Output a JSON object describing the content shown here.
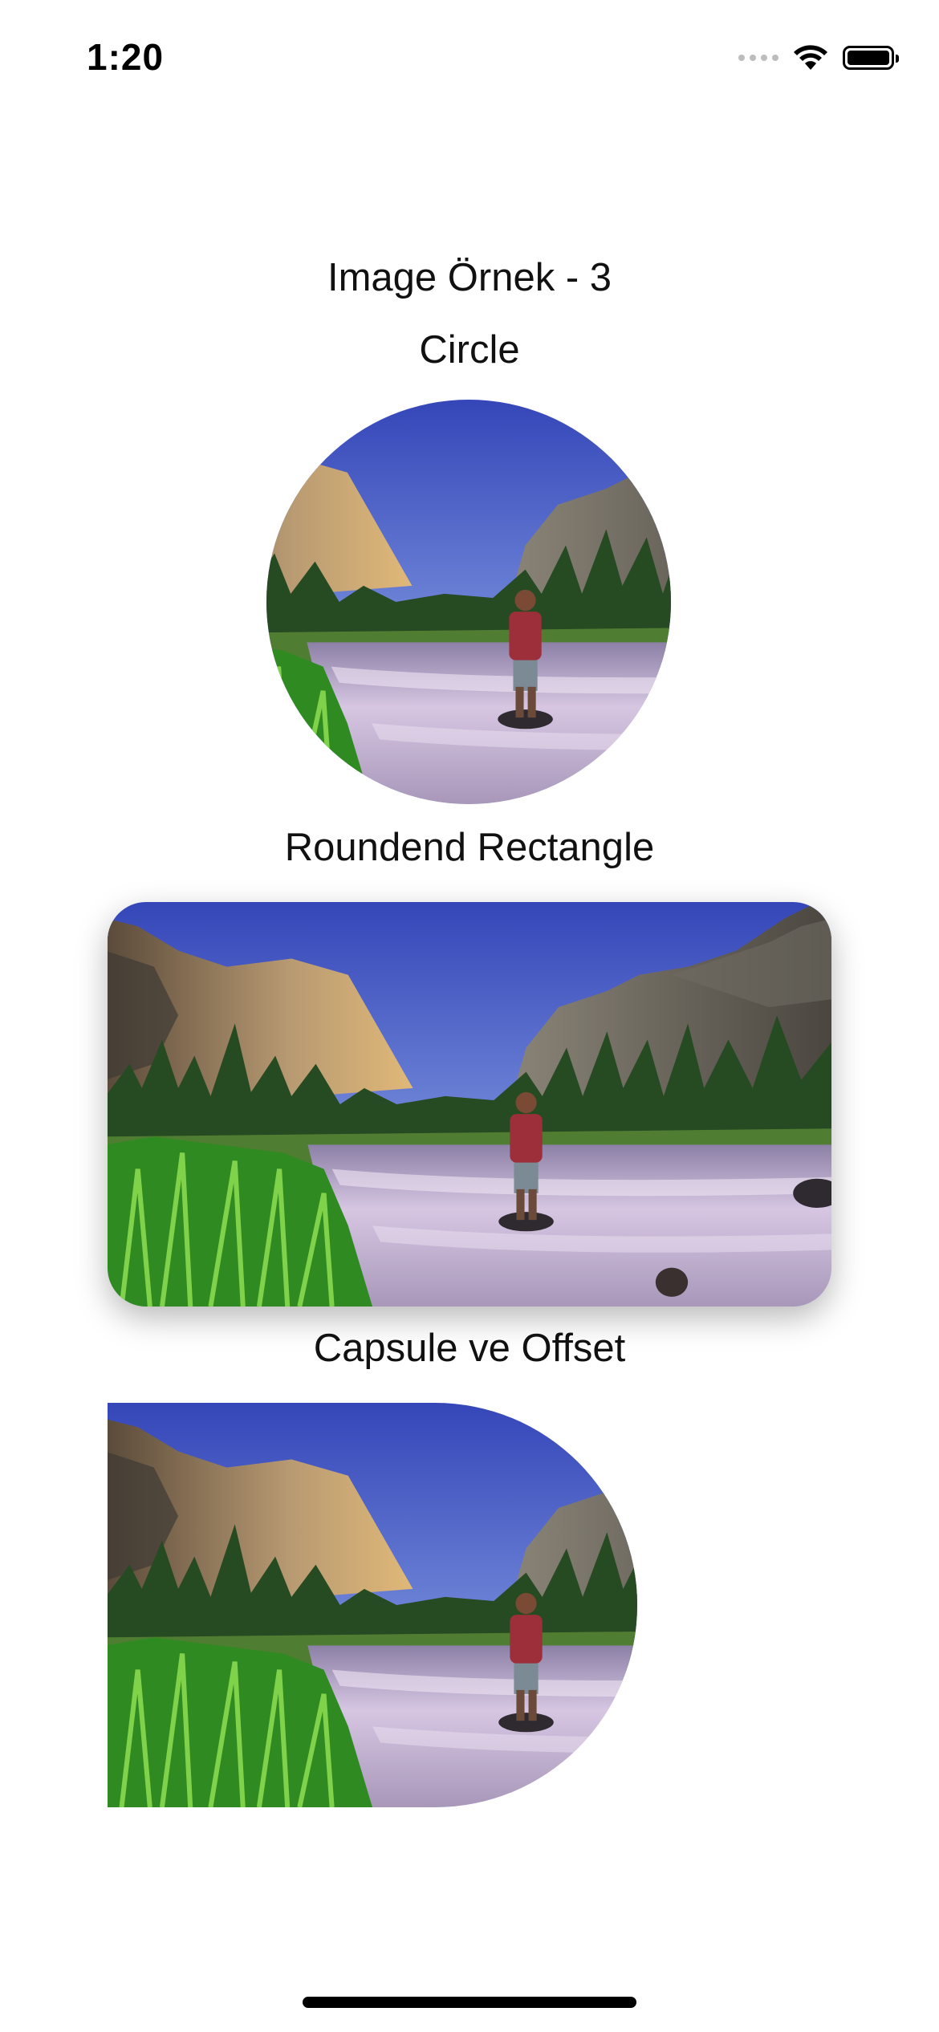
{
  "status_bar": {
    "time": "1:20",
    "icons": [
      "signal-icon",
      "wifi-icon",
      "battery-icon"
    ]
  },
  "content": {
    "title": "Image Örnek - 3",
    "sections": [
      {
        "label": "Circle",
        "shape": "circle"
      },
      {
        "label": "Roundend Rectangle",
        "shape": "rounded-rectangle"
      },
      {
        "label": "Capsule ve Offset",
        "shape": "capsule"
      }
    ]
  },
  "image": {
    "description_icon": "landscape-photo"
  },
  "colors": {
    "sky_top": "#3a4fc2",
    "sky_bottom": "#b8c8f0",
    "rock": "#a89070",
    "trees": "#2f5a2a",
    "water": "#cbb8d8",
    "grass": "#3f9a2a"
  }
}
